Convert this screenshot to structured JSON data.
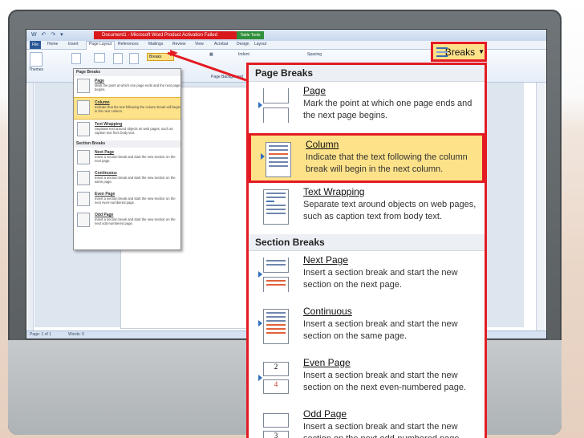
{
  "window": {
    "doc_title": "Document1 - Microsoft Word Product Activation Failed",
    "table_tools": "Table Tools"
  },
  "tabs": [
    "File",
    "Home",
    "Insert",
    "Page Layout",
    "References",
    "Mailings",
    "Review",
    "View",
    "Acrobat",
    "Design",
    "Layout"
  ],
  "ribbon": {
    "themes": "Themes",
    "orientation": "Orientation",
    "breaks_small": "Breaks",
    "indent": "Indent",
    "spacing": "Spacing",
    "page_background": "Page Background",
    "page_setup": "Page Setup"
  },
  "status": {
    "page": "Page: 1 of 1",
    "words": "Words: 0"
  },
  "breaks_button": "Breaks",
  "menu": {
    "page_breaks_header": "Page Breaks",
    "section_breaks_header": "Section Breaks",
    "page_break_items": [
      {
        "title": "Page",
        "desc": "Mark the point at which one page ends and the next page begins."
      },
      {
        "title": "Column",
        "desc": "Indicate that the text following the column break will begin in the next column."
      },
      {
        "title": "Text Wrapping",
        "desc": "Separate text around objects on web pages, such as caption text from body text."
      }
    ],
    "section_break_items": [
      {
        "title": "Next Page",
        "desc": "Insert a section break and start the new section on the next page."
      },
      {
        "title": "Continuous",
        "desc": "Insert a section break and start the new section on the same page."
      },
      {
        "title": "Even Page",
        "desc": "Insert a section break and start the new section on the next even-numbered page."
      },
      {
        "title": "Odd Page",
        "desc": "Insert a section break and start the new section on the next odd-numbered page."
      }
    ]
  },
  "small_menu": {
    "page_breaks_header": "Page Breaks",
    "section_breaks_header": "Section Breaks",
    "items": [
      {
        "title": "Page",
        "desc": "Mark the point at which one page ends and the next page begins."
      },
      {
        "title": "Column",
        "desc": "Indicate that the text following the column break will begin in the next column."
      },
      {
        "title": "Text Wrapping",
        "desc": "Separate text around objects on web pages, such as caption text from body text."
      },
      {
        "title": "Next Page",
        "desc": "Insert a section break and start the new section on the next page."
      },
      {
        "title": "Continuous",
        "desc": "Insert a section break and start the new section on the same page."
      },
      {
        "title": "Even Page",
        "desc": "Insert a section break and start the new section on the next even-numbered page."
      },
      {
        "title": "Odd Page",
        "desc": "Insert a section break and start the new section on the next odd-numbered page."
      }
    ]
  },
  "colors": {
    "highlight": "#fde28a",
    "callout_red": "#e31b23",
    "monitor": "#5f6467"
  }
}
